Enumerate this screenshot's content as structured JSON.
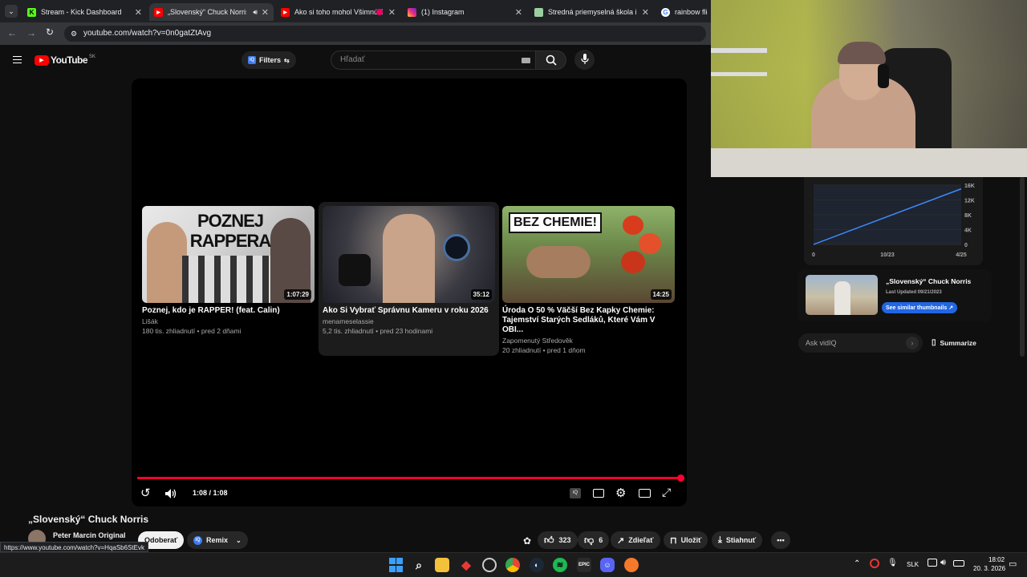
{
  "browser": {
    "tabs": [
      {
        "title": "Stream - Kick Dashboard",
        "active": false
      },
      {
        "title": "„Slovenský“ Chuck Norris -",
        "active": true
      },
      {
        "title": "Ako si toho mohol Všimnúť?",
        "active": false
      },
      {
        "title": "(1) Instagram",
        "active": false
      },
      {
        "title": "Stredná priemyselná škola infor",
        "active": false
      },
      {
        "title": "rainbow flick",
        "active": false
      }
    ],
    "url": "youtube.com/watch?v=0n0gatZtAvg",
    "status_url": "https://www.youtube.com/watch?v=HqaSb6StEvk"
  },
  "youtube": {
    "logo": "YouTube",
    "region": "SK",
    "filters_label": "Filters",
    "search_placeholder": "Hľadať",
    "end_cards": [
      {
        "title": "Poznej, kdo je RAPPER! (feat. Calin)",
        "channel": "Lišák",
        "meta": "180 tis. zhliadnutí • pred 2 dňami",
        "duration": "1:07:29",
        "thumb_text": "POZNEJ RAPPERA"
      },
      {
        "title": "Ako Si Vybrať Správnu Kameru v roku 2026",
        "channel": "menameselassie",
        "meta": "5,2 tis. zhliadnutí • pred 23 hodinami",
        "duration": "35:12",
        "thumb_text": ""
      },
      {
        "title": "Úroda O 50 % Väčší Bez Kapky Chemie: Tajemství Starých Sedláků, Které Vám V OBI...",
        "channel": "Zapomenutý Středověk",
        "meta": "20 zhliadnutí • pred 1 dňom",
        "duration": "14:25",
        "thumb_text": "BEZ CHEMIE!"
      }
    ],
    "time_display": "1:08 / 1:08",
    "progress": 1.0,
    "video_title": "„Slovenský“ Chuck Norris",
    "channel_name": "Peter Marcin Original",
    "unsubscribe_label": "Odoberať",
    "remix_label": "Remix",
    "likes": "323",
    "dislikes": "6",
    "share_label": "Zdieľať",
    "save_label": "Uložiť",
    "download_label": "Stiahnuť"
  },
  "vidiq": {
    "chart_data": {
      "type": "line",
      "x": [
        "0",
        "10/23",
        "4/25"
      ],
      "y_ticks": [
        "16K",
        "12K",
        "8K",
        "4K",
        "0"
      ],
      "series": [
        {
          "values": [
            0,
            15000
          ]
        }
      ],
      "ylim": [
        0,
        16000
      ]
    },
    "thumb_title": "„Slovenský“ Chuck Norris",
    "last_updated": "Last Updated 09/21/2023",
    "similar_button": "See similar thumbnails ↗",
    "ask_placeholder": "Ask vidIQ",
    "summarize_label": "Summarize"
  },
  "taskbar": {
    "language": "SLK",
    "time": "18:02",
    "date": "20. 3. 2026"
  }
}
